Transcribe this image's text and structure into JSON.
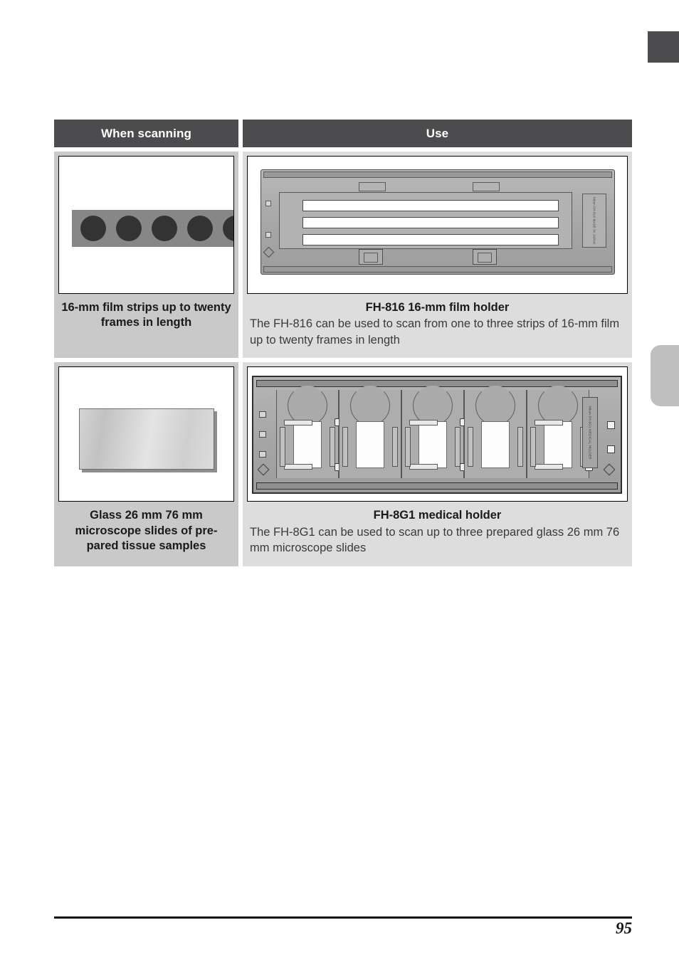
{
  "page": {
    "number": "95"
  },
  "table": {
    "headers": {
      "left": "When scanning",
      "right": "Use"
    },
    "rows": [
      {
        "left_caption": "16-mm film strips up to twenty frames in length",
        "left_figure": "16mm-film-strip-illustration",
        "right_title": "FH-816 16-mm film holder",
        "right_body": "The FH-816 can be used to scan from one to three strips of 16-mm film up to twenty frames in length",
        "right_figure": "fh-816-film-holder-illustration",
        "holder_label_text": "Nikon FH-816 MADE IN JAPAN"
      },
      {
        "left_caption": "Glass 26 mm    76 mm microscope slides of pre-pared tissue samples",
        "left_figure": "glass-microscope-slide-illustration",
        "right_title": "FH-8G1 medical holder",
        "right_body": "The FH-8G1 can be used to scan up to three prepared glass 26 mm 76 mm microscope slides",
        "right_figure": "fh-8g1-medical-holder-illustration",
        "holder_label_text": "Nikon FH-8G1 MEDICAL HOLDER"
      }
    ]
  },
  "colors": {
    "header_bg": "#4c4c4e",
    "cell_left_bg": "#c9c9c9",
    "cell_right_bg": "#dddddd",
    "text_dark": "#1a1a1a",
    "body_text": "#3a3a3a",
    "corner_tab": "#4c4c4e",
    "side_tab": "#bfbfbf"
  }
}
